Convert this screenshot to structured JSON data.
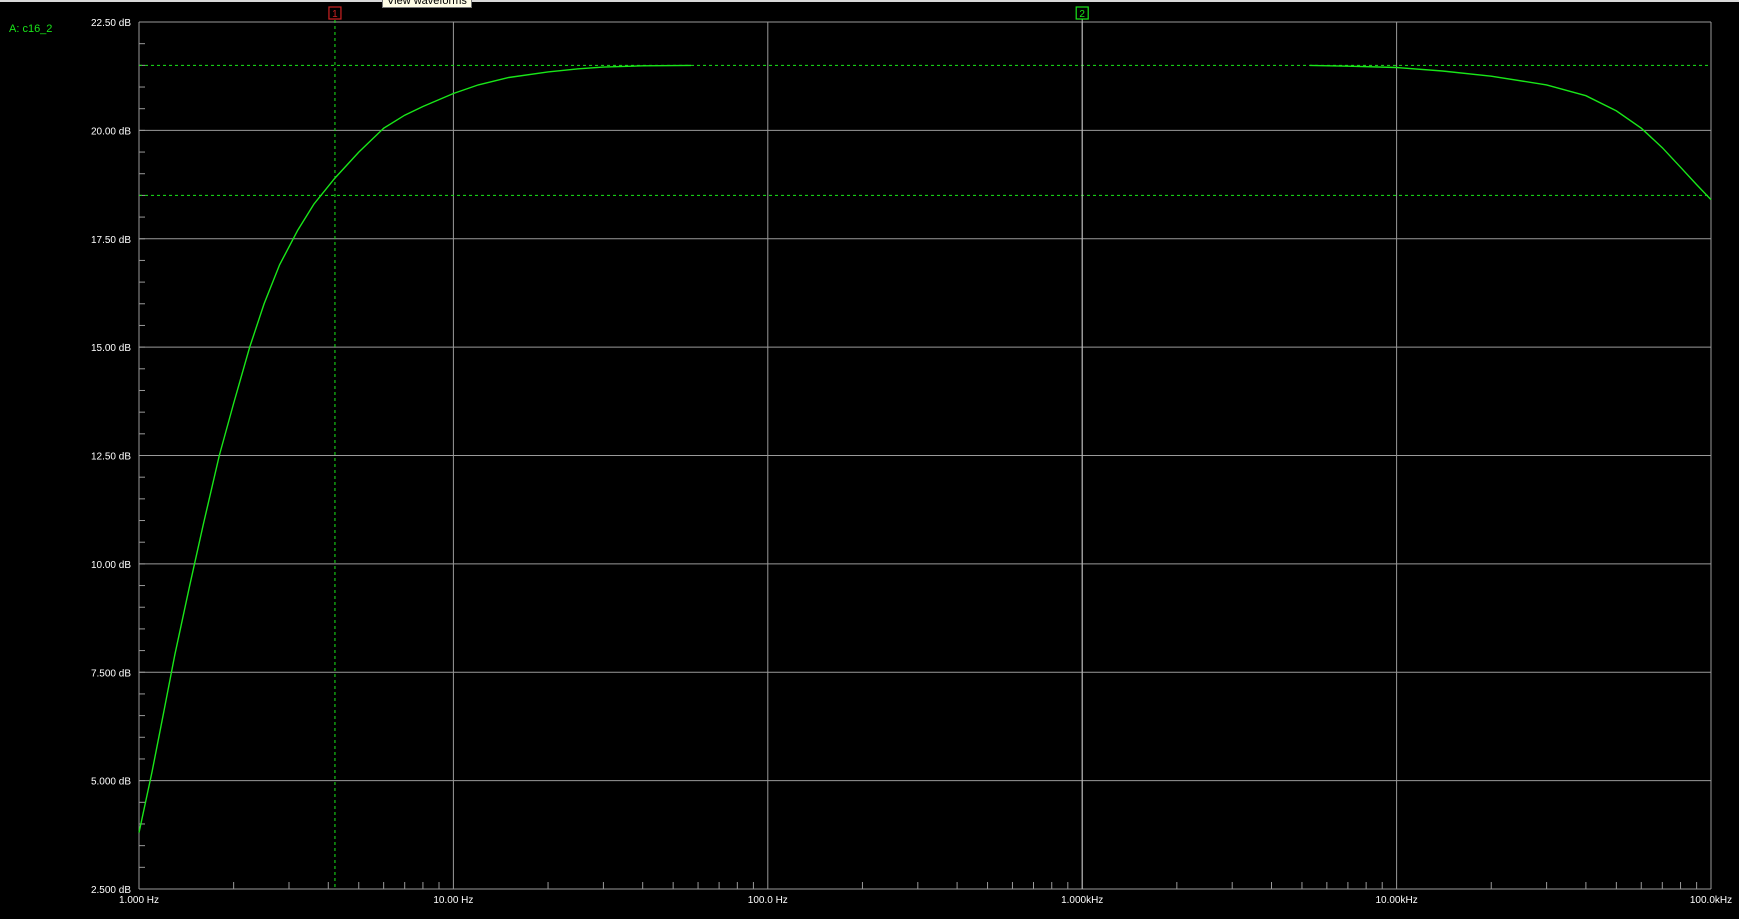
{
  "tooltip": "View waveforms",
  "trace_label": "A: c16_2",
  "colors": {
    "background": "#000000",
    "grid": "#9a9a9a",
    "trace": "#19e619",
    "cursor_1": "#cc2222",
    "cursor_2": "#19e619"
  },
  "cursors": [
    {
      "label": "1",
      "x": 4.2
    },
    {
      "label": "2",
      "x": 1000
    }
  ],
  "chart_data": {
    "type": "line",
    "title": "",
    "xlabel": "",
    "ylabel": "",
    "x_scale": "log",
    "xlim": [
      1,
      100000
    ],
    "ylim": [
      2.5,
      22.5
    ],
    "grid": true,
    "x_tick_labels": [
      {
        "v": 1,
        "label": "1.000 Hz"
      },
      {
        "v": 10,
        "label": "10.00 Hz"
      },
      {
        "v": 100,
        "label": "100.0 Hz"
      },
      {
        "v": 1000,
        "label": "1.000kHz"
      },
      {
        "v": 10000,
        "label": "10.00kHz"
      },
      {
        "v": 100000,
        "label": "100.0kHz"
      }
    ],
    "y_tick_labels": [
      {
        "v": 22.5,
        "label": "22.50 dB"
      },
      {
        "v": 20,
        "label": "20.00 dB"
      },
      {
        "v": 17.5,
        "label": "17.50 dB"
      },
      {
        "v": 15,
        "label": "15.00 dB"
      },
      {
        "v": 12.5,
        "label": "12.50 dB"
      },
      {
        "v": 10,
        "label": "10.00 dB"
      },
      {
        "v": 7.5,
        "label": "7.500 dB"
      },
      {
        "v": 5,
        "label": "5.000 dB"
      },
      {
        "v": 2.5,
        "label": "2.500 dB"
      }
    ],
    "horizontal_cursor_levels": [
      21.5,
      18.5
    ],
    "series": [
      {
        "segments": [
          {
            "x": [
              1,
              1.1,
              1.2,
              1.3,
              1.45,
              1.6,
              1.8,
              2,
              2.25,
              2.5,
              2.8,
              3.2,
              3.6,
              4.2,
              5,
              6,
              7,
              8,
              10,
              12,
              15,
              20,
              25,
              30,
              40,
              57
            ],
            "y": [
              3.8,
              5.2,
              6.6,
              7.9,
              9.5,
              10.9,
              12.5,
              13.7,
              15.0,
              16.0,
              16.9,
              17.7,
              18.3,
              18.9,
              19.5,
              20.05,
              20.35,
              20.55,
              20.85,
              21.05,
              21.22,
              21.35,
              21.42,
              21.46,
              21.49,
              21.5
            ]
          },
          {
            "x": [
              5300,
              7000,
              10000,
              14000,
              20000,
              30000,
              40000,
              50000,
              60000,
              70000,
              80000,
              90000,
              100000
            ],
            "y": [
              21.5,
              21.48,
              21.45,
              21.37,
              21.25,
              21.05,
              20.8,
              20.45,
              20.05,
              19.6,
              19.15,
              18.75,
              18.4
            ]
          }
        ]
      }
    ]
  }
}
